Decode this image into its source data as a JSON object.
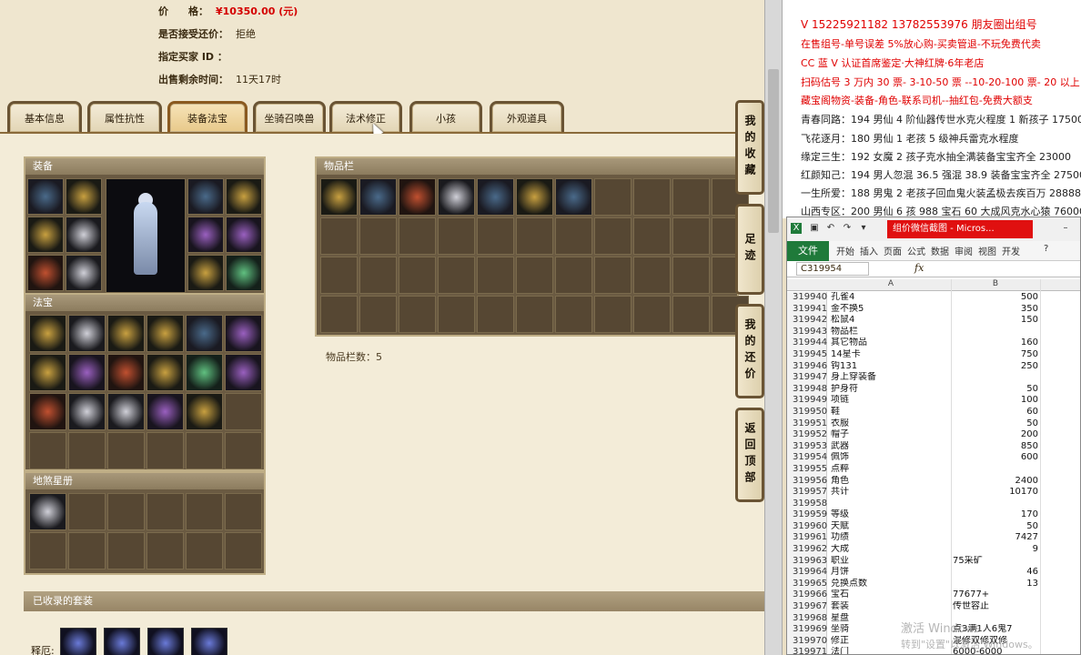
{
  "listing": {
    "price_label": "价　　格：",
    "price_value": "¥10350.00 (元)",
    "counter_label": "是否接受还价：",
    "counter_value": "拒绝",
    "buyer_label": "指定买家 ID ：",
    "buyer_value": "",
    "time_label": "出售剩余时间：",
    "time_value": "11天17时"
  },
  "tabs": [
    "基本信息",
    "属性抗性",
    "装备法宝",
    "坐骑召唤兽",
    "法术修正",
    "小孩",
    "外观道具"
  ],
  "active_tab": "装备法宝",
  "panels": {
    "equipment": "装备",
    "fabao": "法宝",
    "inventory": "物品栏",
    "inventory_count": "物品栏数：5",
    "star_map": "地煞星册",
    "suits": "已收录的套装",
    "suit_label": "释厄:"
  },
  "side_tabs": [
    "我的收藏",
    "足迹",
    "我的还价",
    "返回顶部"
  ],
  "doc_lines": [
    {
      "text": "V 15225921182   13782553976 朋友圈出组号",
      "style": "red big"
    },
    {
      "text": "在售组号-单号误差 5%放心购-买卖管退-不玩免费代卖",
      "style": "red"
    },
    {
      "text": "CC 蓝 V 认证首席鉴定·大神红牌·6年老店",
      "style": "red"
    },
    {
      "text": "扫码估号 3 万内 30 票- 3-10-50 票 --10-20-100 票- 20 以上 150",
      "style": "red"
    },
    {
      "text": "藏宝阁物资-装备-角色-联系司机--抽红包-免费大额支",
      "style": "red"
    },
    {
      "text": "青春同路：194 男仙 4 阶仙器传世水克火程度 1 新孩子 17500",
      "style": ""
    },
    {
      "text": "飞花逐月：180 男仙 1 老孩 5 级神兵雷克水程度",
      "style": ""
    },
    {
      "text": "缘定三生：192 女魔 2 孩子克水抽全满装备宝宝齐全 23000",
      "style": ""
    },
    {
      "text": "红颜知己：194 男人忽混 36.5 强混 38.9 装备宝宝齐全 27500",
      "style": ""
    },
    {
      "text": "一生所爱：188 男鬼 2 老孩子回血鬼火装孟极去疾百万 28888",
      "style": ""
    },
    {
      "text": "山西专区：200 男仙 6 孩 988 宝石 60 大成风克水心猿 76000",
      "style": ""
    }
  ],
  "excel": {
    "title": "组价微信截图 - Micros...",
    "file_tab": "文件",
    "ribbon_tabs": [
      "开始",
      "插入",
      "页面",
      "公式",
      "数据",
      "审阅",
      "视图",
      "开发"
    ],
    "name_box": "C319954",
    "fx": "fx",
    "col_a": "A",
    "col_b": "B",
    "rows": [
      {
        "n": "319940",
        "a": "孔雀4",
        "b": "500",
        "bl": false
      },
      {
        "n": "319941",
        "a": "金不换5",
        "b": "350",
        "bl": false
      },
      {
        "n": "319942",
        "a": "松鼠4",
        "b": "150",
        "bl": false
      },
      {
        "n": "319943",
        "a": "物品栏",
        "b": "",
        "bl": false
      },
      {
        "n": "319944",
        "a": "其它物品",
        "b": "160",
        "bl": false
      },
      {
        "n": "319945",
        "a": "14星卡",
        "b": "750",
        "bl": false
      },
      {
        "n": "319946",
        "a": "钩131",
        "b": "250",
        "bl": false
      },
      {
        "n": "319947",
        "a": "身上穿装备",
        "b": "",
        "bl": false
      },
      {
        "n": "319948",
        "a": "护身符",
        "b": "50",
        "bl": false
      },
      {
        "n": "319949",
        "a": "项链",
        "b": "100",
        "bl": false
      },
      {
        "n": "319950",
        "a": "鞋",
        "b": "60",
        "bl": false
      },
      {
        "n": "319951",
        "a": "衣服",
        "b": "50",
        "bl": false
      },
      {
        "n": "319952",
        "a": "帽子",
        "b": "200",
        "bl": false
      },
      {
        "n": "319953",
        "a": "武器",
        "b": "850",
        "bl": false
      },
      {
        "n": "319954",
        "a": "佩饰",
        "b": "600",
        "bl": false
      },
      {
        "n": "319955",
        "a": "点粹",
        "b": "",
        "bl": false
      },
      {
        "n": "319956",
        "a": "角色",
        "b": "2400",
        "bl": false
      },
      {
        "n": "319957",
        "a": "共计",
        "b": "10170",
        "bl": false
      },
      {
        "n": "319958",
        "a": "",
        "b": "",
        "bl": false
      },
      {
        "n": "319959",
        "a": "等级",
        "b": "170",
        "bl": false
      },
      {
        "n": "319960",
        "a": "天赋",
        "b": "50",
        "bl": false
      },
      {
        "n": "319961",
        "a": "功绩",
        "b": "7427",
        "bl": false
      },
      {
        "n": "319962",
        "a": "大成",
        "b": "9",
        "bl": false
      },
      {
        "n": "319963",
        "a": "职业",
        "b": "75采矿",
        "bl": true
      },
      {
        "n": "319964",
        "a": "月饼",
        "b": "46",
        "bl": false
      },
      {
        "n": "319965",
        "a": "兑换点数",
        "b": "13",
        "bl": false
      },
      {
        "n": "319966",
        "a": "宝石",
        "b": "77677+",
        "bl": true
      },
      {
        "n": "319967",
        "a": "套装",
        "b": "传世容止",
        "bl": true
      },
      {
        "n": "319968",
        "a": "星盘",
        "b": "",
        "bl": false
      },
      {
        "n": "319969",
        "a": "坐骑",
        "b": "点3满1人6鬼7",
        "bl": true
      },
      {
        "n": "319970",
        "a": "修正",
        "b": "混修双修双修",
        "bl": true
      },
      {
        "n": "319971",
        "a": "法门",
        "b": "6000-6000",
        "bl": true
      }
    ]
  },
  "watermark": "激活 Windows",
  "watermark_sub": "转到\"设置\"以激活 Windows。"
}
